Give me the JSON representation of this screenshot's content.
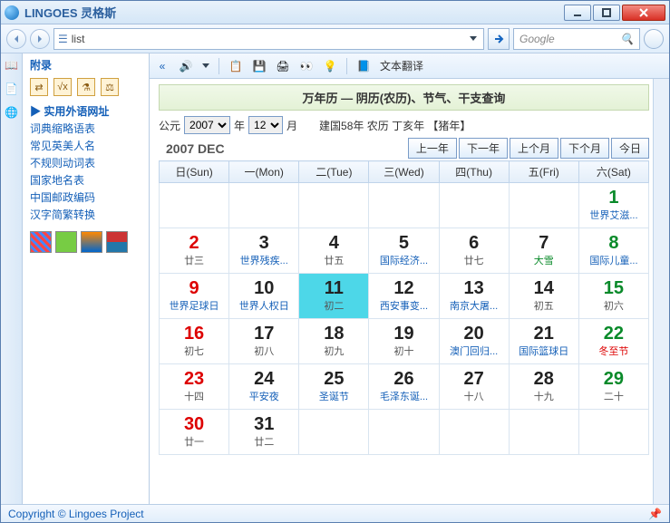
{
  "window": {
    "title": "LINGOES 灵格斯"
  },
  "toolbar": {
    "list_label": "list",
    "google_placeholder": "Google"
  },
  "sidebar": {
    "header": "附录",
    "active": "▶ 实用外语网址",
    "items": [
      "词典缩略语表",
      "常见英美人名",
      "不规则动词表",
      "国家地名表",
      "中国邮政编码",
      "汉字简繁转换"
    ]
  },
  "toolbar2": {
    "translate": "文本翻译"
  },
  "cal": {
    "title": "万年历 — 阴历(农历)、节气、干支查询",
    "ad_label": "公元",
    "year": "2007",
    "year_suffix": "年",
    "month": "12",
    "month_suffix": "月",
    "info": "建国58年 农历 丁亥年 【猪年】",
    "month_label": "2007 DEC",
    "nav": {
      "prev_year": "上一年",
      "next_year": "下一年",
      "prev_month": "上个月",
      "next_month": "下个月",
      "today": "今日"
    },
    "dow": [
      "日(Sun)",
      "一(Mon)",
      "二(Tue)",
      "三(Wed)",
      "四(Thu)",
      "五(Fri)",
      "六(Sat)"
    ],
    "weeks": [
      [
        null,
        null,
        null,
        null,
        null,
        null,
        {
          "n": "1",
          "s": "世界艾滋...",
          "sc": "blue",
          "c": "sat"
        }
      ],
      [
        {
          "n": "2",
          "s": "廿三",
          "c": "sun"
        },
        {
          "n": "3",
          "s": "世界残疾...",
          "sc": "blue"
        },
        {
          "n": "4",
          "s": "廿五"
        },
        {
          "n": "5",
          "s": "国际经济...",
          "sc": "blue"
        },
        {
          "n": "6",
          "s": "廿七"
        },
        {
          "n": "7",
          "s": "大雪",
          "sc": "green"
        },
        {
          "n": "8",
          "s": "国际儿童...",
          "sc": "blue",
          "c": "sat"
        }
      ],
      [
        {
          "n": "9",
          "s": "世界足球日",
          "sc": "blue",
          "c": "sun"
        },
        {
          "n": "10",
          "s": "世界人权日",
          "sc": "blue"
        },
        {
          "n": "11",
          "s": "初二",
          "today": true
        },
        {
          "n": "12",
          "s": "西安事变...",
          "sc": "blue"
        },
        {
          "n": "13",
          "s": "南京大屠...",
          "sc": "blue"
        },
        {
          "n": "14",
          "s": "初五"
        },
        {
          "n": "15",
          "s": "初六",
          "c": "sat"
        }
      ],
      [
        {
          "n": "16",
          "s": "初七",
          "c": "sun"
        },
        {
          "n": "17",
          "s": "初八"
        },
        {
          "n": "18",
          "s": "初九"
        },
        {
          "n": "19",
          "s": "初十"
        },
        {
          "n": "20",
          "s": "澳门回归...",
          "sc": "blue"
        },
        {
          "n": "21",
          "s": "国际篮球日",
          "sc": "blue"
        },
        {
          "n": "22",
          "s": "冬至节",
          "sc": "red",
          "c": "sat"
        }
      ],
      [
        {
          "n": "23",
          "s": "十四",
          "c": "sun"
        },
        {
          "n": "24",
          "s": "平安夜",
          "sc": "blue"
        },
        {
          "n": "25",
          "s": "圣诞节",
          "sc": "blue"
        },
        {
          "n": "26",
          "s": "毛泽东诞...",
          "sc": "blue"
        },
        {
          "n": "27",
          "s": "十八"
        },
        {
          "n": "28",
          "s": "十九"
        },
        {
          "n": "29",
          "s": "二十",
          "c": "sat"
        }
      ],
      [
        {
          "n": "30",
          "s": "廿一",
          "c": "sun"
        },
        {
          "n": "31",
          "s": "廿二"
        },
        null,
        null,
        null,
        null,
        null
      ]
    ]
  },
  "status": {
    "copyright": "Copyright © Lingoes Project"
  }
}
